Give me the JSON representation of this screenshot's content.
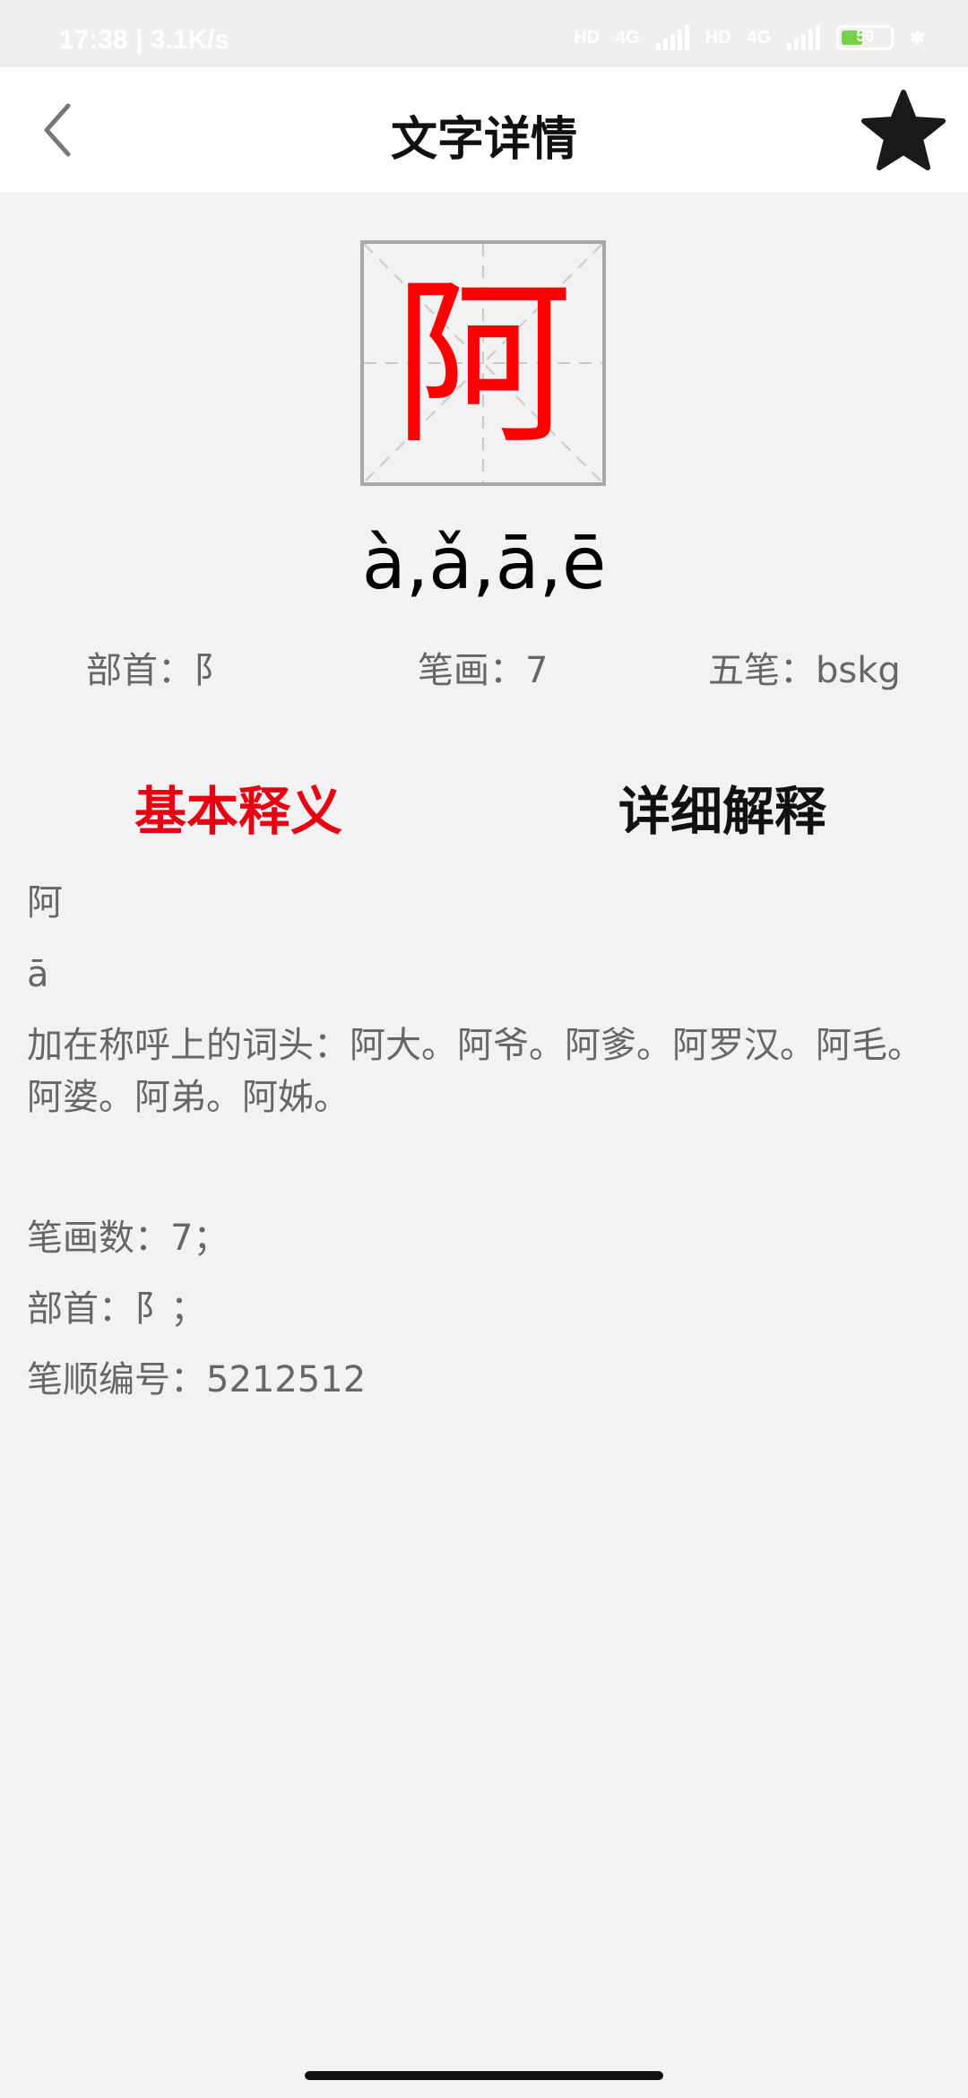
{
  "status_bar": {
    "time": "17:38 | 3.1K/s",
    "hd1": "HD",
    "net1": "4G",
    "hd2": "HD",
    "net2": "4G",
    "battery_level": "50"
  },
  "app_bar": {
    "title": "文字详情",
    "back_icon": "chevron-left-icon",
    "favorite_icon": "star-icon"
  },
  "character": {
    "glyph": "阿",
    "pinyin": "à,ǎ,ā,ē",
    "glyph_color": "#ff0000"
  },
  "meta": {
    "radical": "部首：阝",
    "strokes": "笔画：7",
    "wubi": "五笔：bskg"
  },
  "tabs": [
    {
      "label": "基本释义",
      "active": true
    },
    {
      "label": "详细解释",
      "active": false
    }
  ],
  "content": {
    "char": "阿",
    "pinyin": "ā",
    "definition": "加在称呼上的词头：阿大。阿爷。阿爹。阿罗汉。阿毛。阿婆。阿弟。阿姊。",
    "stroke_count": "笔画数：7；",
    "radical": "部首：阝；",
    "stroke_order": "笔顺编号：5212512"
  },
  "colors": {
    "accent": "#e60012",
    "background": "#f2f2f2"
  }
}
